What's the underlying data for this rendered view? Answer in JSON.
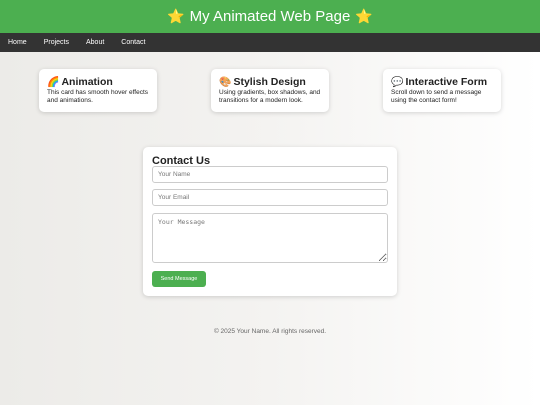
{
  "header": {
    "title": "My Animated Web Page",
    "star_icon": "⭐",
    "bg_color": "#4caf50"
  },
  "nav": {
    "items": [
      {
        "label": "Home"
      },
      {
        "label": "Projects"
      },
      {
        "label": "About"
      },
      {
        "label": "Contact"
      }
    ],
    "bg_color": "#333333"
  },
  "cards": [
    {
      "icon": "🌈",
      "icon_name": "rainbow-icon",
      "title": "Animation",
      "text": "This card has smooth hover effects and animations."
    },
    {
      "icon": "🎨",
      "icon_name": "palette-icon",
      "title": "Stylish Design",
      "text": "Using gradients, box shadows, and transitions for a modern look."
    },
    {
      "icon": "💬",
      "icon_name": "speech-bubble-icon",
      "title": "Interactive Form",
      "text": "Scroll down to send a message using the contact form!"
    }
  ],
  "contact": {
    "title": "Contact Us",
    "name_placeholder": "Your Name",
    "email_placeholder": "Your Email",
    "message_placeholder": "Your Message",
    "submit_label": "Send Message",
    "accent_color": "#4caf50"
  },
  "footer": {
    "text": "© 2025 Your Name. All rights reserved."
  }
}
